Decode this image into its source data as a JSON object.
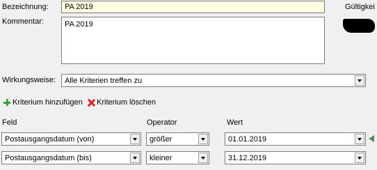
{
  "fields": {
    "bezeichnung_label": "Bezeichnung:",
    "bezeichnung_value": "PA 2019",
    "kommentar_label": "Kommentar:",
    "kommentar_value": "PA 2019",
    "gueltigkeit_label": "Gültigkei",
    "wirkungsweise_label": "Wirkungsweise:",
    "wirkungsweise_value": "Alle Kriterien treffen zu"
  },
  "toolbar": {
    "add_label": "Kriterium hinzufügen",
    "delete_label": "Kriterium löschen"
  },
  "criteria": {
    "headers": {
      "feld": "Feld",
      "operator": "Operator",
      "wert": "Wert"
    },
    "rows": [
      {
        "feld": "Postausgangsdatum (von)",
        "operator": "größer",
        "wert": "01.01.2019"
      },
      {
        "feld": "Postausgangsdatum (bis)",
        "operator": "kleiner",
        "wert": "31.12.2019"
      }
    ]
  },
  "colors": {
    "highlight_field": "#ffffe1",
    "add_icon": "#3aa23a",
    "delete_icon": "#dd2222",
    "row_marker": "#5a8a5a"
  }
}
